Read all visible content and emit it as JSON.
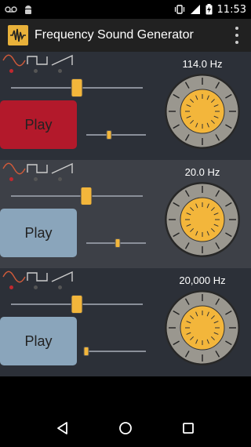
{
  "status": {
    "time": "11:53"
  },
  "app": {
    "title": "Frequency Sound Generator"
  },
  "icons": {
    "status_left": [
      "voicemail-icon",
      "android-icon"
    ],
    "status_right": [
      "vibrate-icon",
      "signal-icon",
      "battery-charging-icon"
    ],
    "nav": [
      "back-icon",
      "home-icon",
      "recents-icon"
    ],
    "waves": [
      "sine-wave-icon",
      "square-wave-icon",
      "sawtooth-wave-icon"
    ]
  },
  "colors": {
    "accent": "#f3b63b",
    "play_active": "#b3192b",
    "play_idle": "#8aa5bb",
    "wave_sine": "#d05a3a",
    "dot_selected": "#c0282f"
  },
  "generators": [
    {
      "frequency": "114.0 Hz",
      "play_label": "Play",
      "playing": true,
      "selected_wave": 0,
      "freq_slider": 0.5,
      "volume": 0.38
    },
    {
      "frequency": "20.0 Hz",
      "play_label": "Play",
      "playing": false,
      "selected_wave": 0,
      "freq_slider": 0.57,
      "volume": 0.53
    },
    {
      "frequency": "20,000 Hz",
      "play_label": "Play",
      "playing": false,
      "selected_wave": 0,
      "freq_slider": 0.5,
      "volume": 0.0
    }
  ]
}
